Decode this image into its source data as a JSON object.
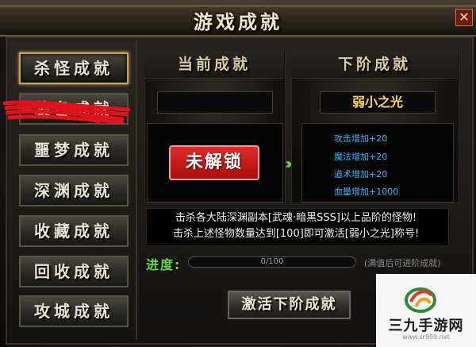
{
  "window": {
    "title": "游戏成就",
    "close_icon": "close-icon"
  },
  "sidebar": {
    "items": [
      {
        "label": "杀怪成就",
        "active": true
      },
      {
        "label": "装备成就",
        "active": false
      },
      {
        "label": "噩梦成就",
        "active": false
      },
      {
        "label": "深渊成就",
        "active": false
      },
      {
        "label": "收藏成就",
        "active": false
      },
      {
        "label": "回收成就",
        "active": false
      },
      {
        "label": "攻城成就",
        "active": false
      }
    ]
  },
  "current": {
    "header": "当前成就",
    "name": "",
    "status_button": "未解锁"
  },
  "next": {
    "header": "下阶成就",
    "name": "弱小之光",
    "stats": [
      "攻击增加+20",
      "魔法增加+20",
      "道术增加+20",
      "血量增加+1000"
    ]
  },
  "description": {
    "line1": "击杀各大陆深渊副本[武魂·暗黑SSS]以上品阶的怪物!",
    "line2": "击杀上述怪物数量达到[100]即可激活[弱小之光]称号!"
  },
  "progress": {
    "label": "进度:",
    "current": 0,
    "total": 100,
    "text": "0/100",
    "hint": "(满值后可进阶成就)"
  },
  "activate_button": "激活下阶成就",
  "watermark": {
    "name": "三九手游网",
    "url": "www.sr999.net"
  },
  "colors": {
    "accent_gold": "#ffd75a",
    "stat_blue": "#39b6ff",
    "progress_green": "#62d83e",
    "lock_red": "#d01a1a"
  }
}
